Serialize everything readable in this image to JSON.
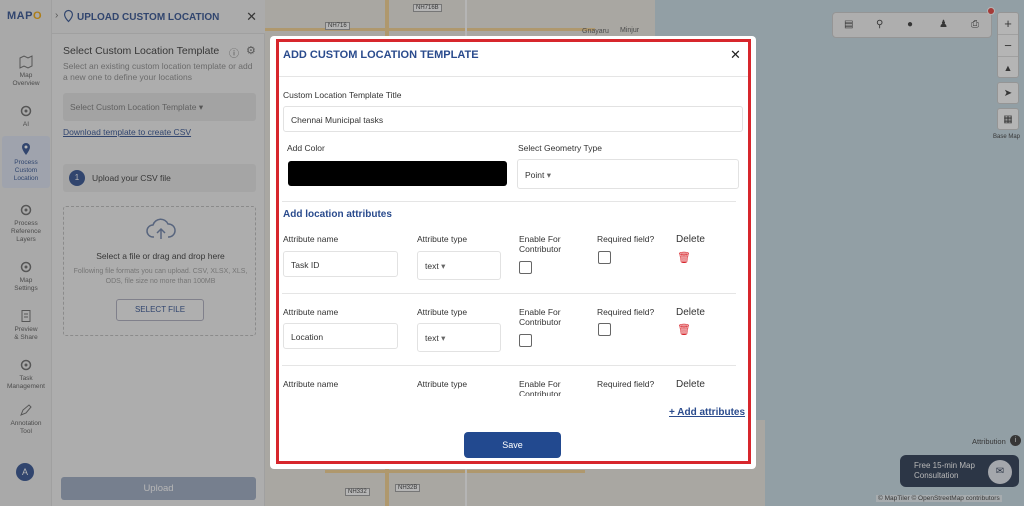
{
  "app": {
    "logo_text_a": "MAP",
    "logo_text_b": "O",
    "logo_text_c": "",
    "colors": {
      "brand": "#2a4b8d",
      "accent": "#f2a500",
      "danger": "#d7262c",
      "save": "#22498f"
    }
  },
  "rail": {
    "items": [
      {
        "label1": "Map",
        "label2": "Overview",
        "icon": "map-icon"
      },
      {
        "label1": "AI",
        "label2": "",
        "icon": "gear-icon"
      },
      {
        "label1": "Process",
        "label2": "Custom",
        "label3": "Location",
        "icon": "location-pin-icon"
      },
      {
        "label1": "Process",
        "label2": "Reference",
        "label3": "Layers",
        "icon": "gear-icon"
      },
      {
        "label1": "Map",
        "label2": "Settings",
        "icon": "gear-icon"
      },
      {
        "label1": "Preview",
        "label2": "& Share",
        "icon": "document-icon"
      },
      {
        "label1": "Task",
        "label2": "Management",
        "icon": "gear-icon"
      },
      {
        "label1": "Annotation",
        "label2": "Tool",
        "icon": "pen-icon"
      }
    ],
    "avatar": "A"
  },
  "panel": {
    "title": "UPLOAD CUSTOM LOCATION",
    "subtitle": "Select Custom Location Template",
    "description": "Select an existing custom location template or add a new one to define your locations",
    "select_placeholder": "Select Custom Location Template",
    "download_link": "Download template to create CSV",
    "step_number": "1",
    "step_label": "Upload your CSV file",
    "drop_title": "Select a file or drag and drop here",
    "drop_hint": "Following file formats you can upload. CSV, XLSX, XLS, ODS, file size no more than 100MB",
    "select_file": "SELECT FILE",
    "upload": "Upload"
  },
  "map": {
    "labels": [
      "Minjur",
      "Gnayaru",
      "NH716B",
      "NH716",
      "NH32",
      "NH332",
      "NH32B"
    ],
    "attribution": "Attribution",
    "base_map": "Base Map",
    "consult": "Free 15-min Map Consultation",
    "consult_line1": "Free 15-min Map",
    "consult_line2": "Consultation",
    "credits": "© MapTiler © OpenStreetMap contributors"
  },
  "modal": {
    "title": "ADD CUSTOM LOCATION TEMPLATE",
    "title_label": "Custom Location Template Title",
    "title_value": "Chennai  Municipal tasks",
    "color_label": "Add Color",
    "color_value": "#000000",
    "geometry_label": "Select Geometry Type",
    "geometry_value": "Point",
    "attributes_heading": "Add location attributes",
    "col_name": "Attribute name",
    "col_type": "Attribute type",
    "col_enable": "Enable For Contributor",
    "col_enable_1": "Enable For",
    "col_enable_2": "Contributor",
    "col_required": "Required field?",
    "col_delete": "Delete",
    "attributes": [
      {
        "name": "Task ID",
        "type": "text",
        "enable": false,
        "required": false
      },
      {
        "name": "Location",
        "type": "text",
        "enable": false,
        "required": false
      },
      {
        "name": "",
        "type": "",
        "enable": false,
        "required": false
      }
    ],
    "add_attributes": "+ Add attributes",
    "save": "Save"
  }
}
